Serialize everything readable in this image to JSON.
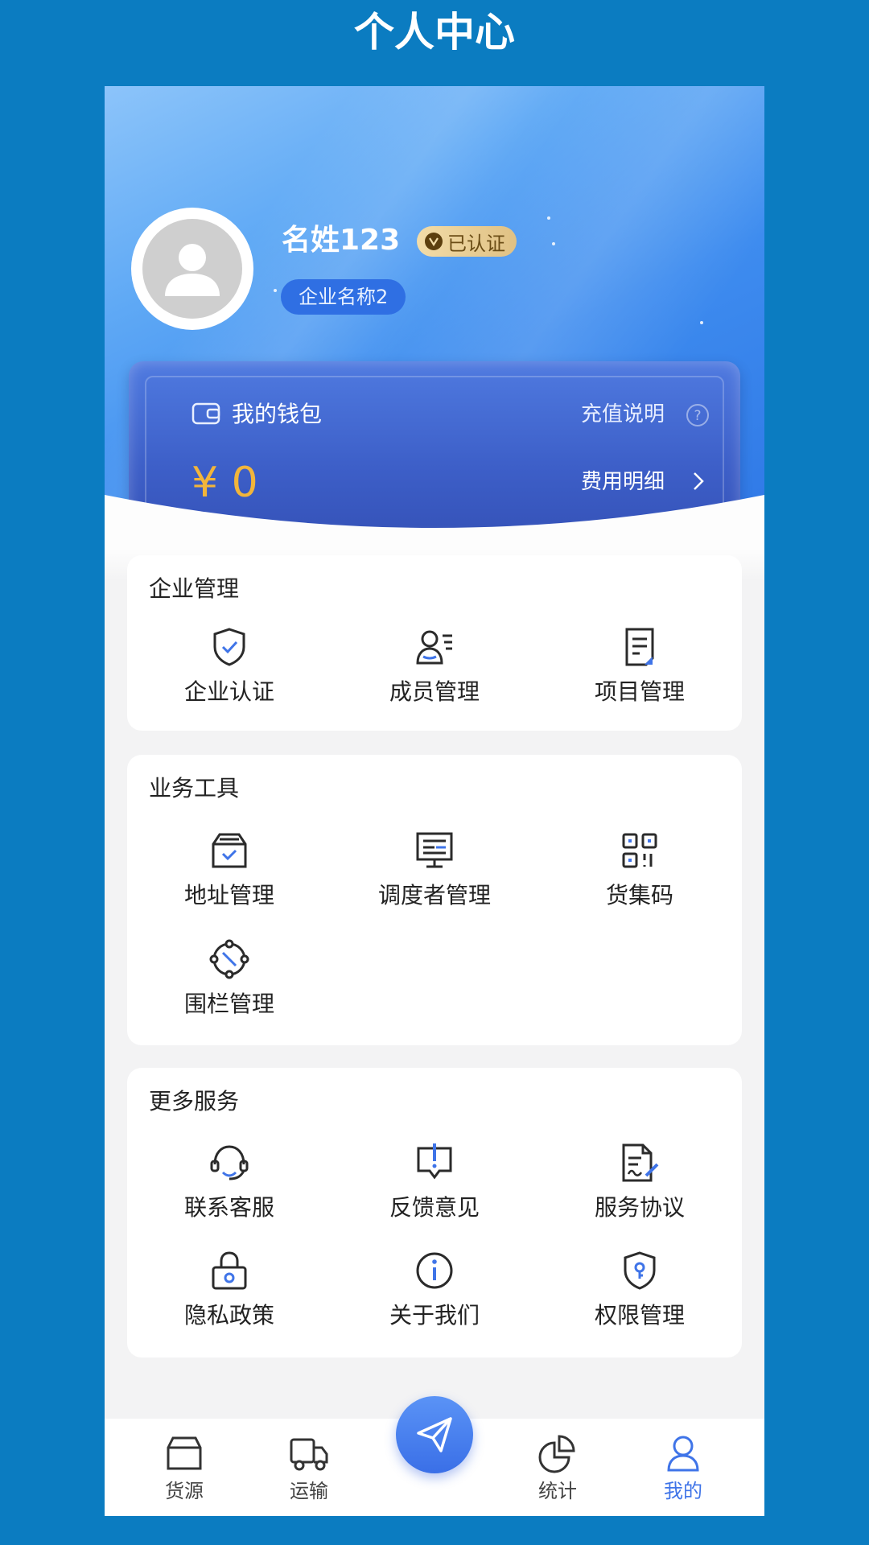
{
  "page": {
    "title": "个人中心"
  },
  "profile": {
    "name": "名姓123",
    "verified_label": "已认证",
    "company": "企业名称2"
  },
  "wallet": {
    "title": "我的钱包",
    "recharge_label": "充值说明",
    "balance": "¥ 0",
    "fee_label": "费用明细"
  },
  "sections": {
    "enterprise": {
      "title": "企业管理",
      "items": [
        {
          "label": "企业认证",
          "icon": "shield-check-icon"
        },
        {
          "label": "成员管理",
          "icon": "member-icon"
        },
        {
          "label": "项目管理",
          "icon": "document-icon"
        }
      ]
    },
    "tools": {
      "title": "业务工具",
      "items": [
        {
          "label": "地址管理",
          "icon": "address-box-icon"
        },
        {
          "label": "调度者管理",
          "icon": "monitor-icon"
        },
        {
          "label": "货集码",
          "icon": "qr-code-icon"
        },
        {
          "label": "围栏管理",
          "icon": "fence-icon"
        }
      ]
    },
    "more": {
      "title": "更多服务",
      "items": [
        {
          "label": "联系客服",
          "icon": "headset-icon"
        },
        {
          "label": "反馈意见",
          "icon": "feedback-icon"
        },
        {
          "label": "服务协议",
          "icon": "agreement-icon"
        },
        {
          "label": "隐私政策",
          "icon": "lock-icon"
        },
        {
          "label": "关于我们",
          "icon": "info-icon"
        },
        {
          "label": "权限管理",
          "icon": "key-shield-icon"
        }
      ]
    }
  },
  "tabbar": {
    "items": [
      {
        "label": "货源",
        "icon": "box-icon"
      },
      {
        "label": "运输",
        "icon": "truck-icon"
      },
      {
        "label": "统计",
        "icon": "pie-chart-icon"
      },
      {
        "label": "我的",
        "icon": "user-icon",
        "active": true
      }
    ]
  },
  "colors": {
    "background": "#0b7cc1",
    "accent": "#3f74e8",
    "gold": "#f2b53b"
  }
}
